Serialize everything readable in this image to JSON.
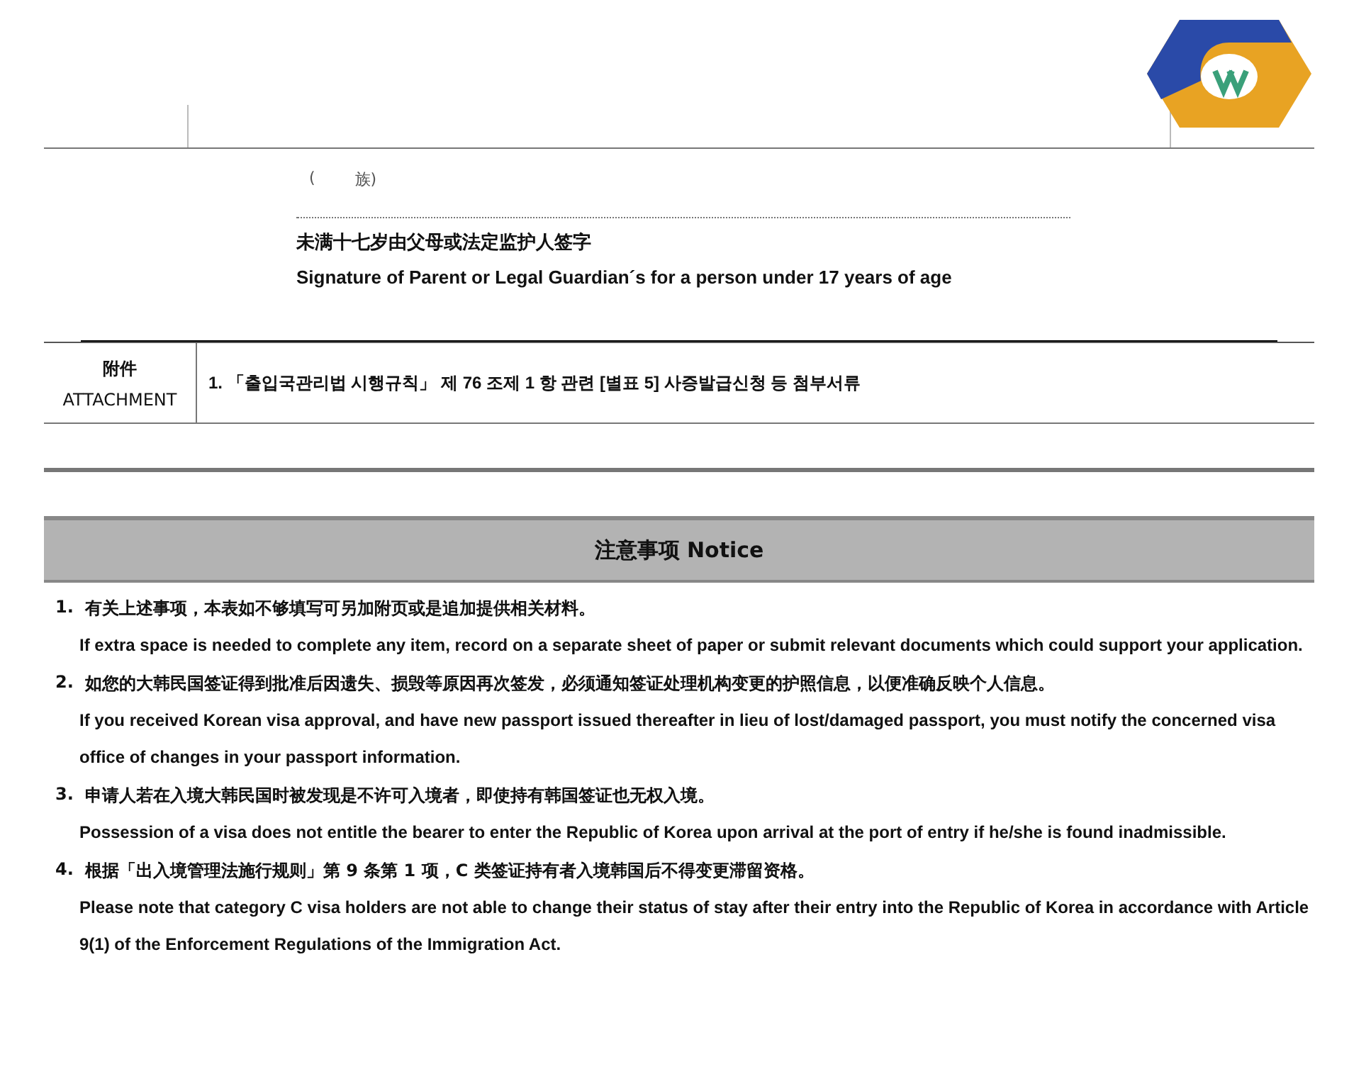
{
  "header": {
    "fragment_left": "(",
    "fragment_right": "族)"
  },
  "signature": {
    "label_zh": "未满十七岁由父母或法定监护人签字",
    "label_en": "Signature of Parent or Legal Guardian´s for a person under 17 years of age"
  },
  "attachment": {
    "label_zh": "附件",
    "label_en": "ATTACHMENT",
    "text": "1. 「출입국관리법 시행규칙」 제 76 조제 1 항 관련 [별표 5] 사증발급신청 등 첨부서류"
  },
  "notice": {
    "title": "注意事项  Notice",
    "items": [
      {
        "number": "1.",
        "zh": "有关上述事项，本表如不够填写可另加附页或是追加提供相关材料。",
        "en": "If extra space is needed to complete any item, record on a separate sheet of paper or submit relevant documents which could support your application."
      },
      {
        "number": "2.",
        "zh": "如您的大韩民国签证得到批准后因遗失、损毁等原因再次签发，必须通知签证处理机构变更的护照信息，以便准确反映个人信息。",
        "en": "If you received Korean visa approval, and have new passport issued thereafter in lieu of lost/damaged passport, you must notify the concerned visa office of changes in your passport information."
      },
      {
        "number": "3.",
        "zh": "申请人若在入境大韩民国时被发现是不许可入境者，即使持有韩国签证也无权入境。",
        "en": "Possession of a visa does not entitle the bearer to enter the Republic of Korea upon arrival at the port of entry if he/she is found inadmissible."
      },
      {
        "number": "4.",
        "zh": "根据「出入境管理法施行规则」第 9 条第 1 项，C 类签证持有者入境韩国后不得变更滞留资格。",
        "en": "Please note that category C visa holders are not able to change their status of stay after their entry into the Republic of Korea in accordance with Article 9(1) of the Enforcement Regulations of the Immigration Act."
      }
    ]
  }
}
